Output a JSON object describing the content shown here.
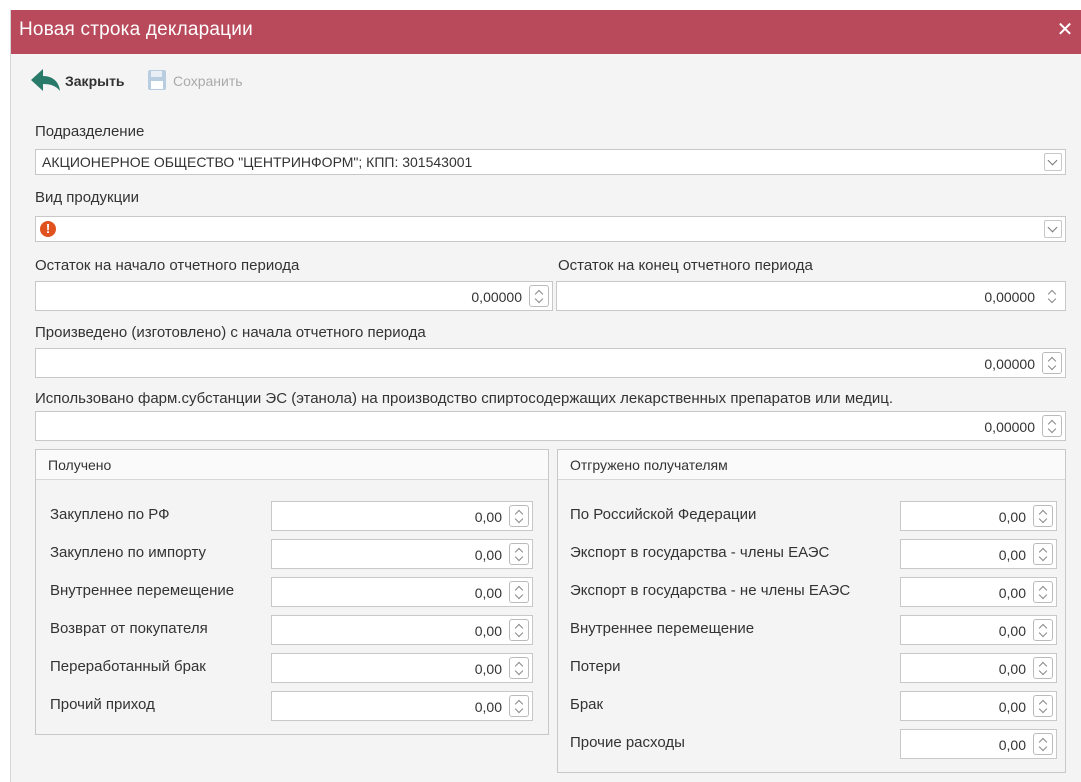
{
  "window": {
    "title": "Новая строка декларации",
    "close_glyph": "✕"
  },
  "toolbar": {
    "close_label": "Закрыть",
    "save_label": "Сохранить"
  },
  "fields": {
    "division_label": "Подразделение",
    "division_value": "АКЦИОНЕРНОЕ ОБЩЕСТВО \"ЦЕНТРИНФОРМ\"; КПП: 301543001",
    "product_type_label": "Вид продукции",
    "product_type_value": "",
    "opening_balance_label": "Остаток на начало отчетного периода",
    "opening_balance_value": "0,00000",
    "closing_balance_label": "Остаток на конец отчетного периода",
    "closing_balance_value": "0,00000",
    "produced_label": "Произведено (изготовлено) с начала отчетного периода",
    "produced_value": "0,00000",
    "used_label": "Использовано фарм.субстанции ЭС (этанола) на производство спиртосодержащих лекарственных препаратов или медиц.",
    "used_value": "0,00000"
  },
  "received": {
    "title": "Получено",
    "rows": [
      {
        "label": "Закуплено по РФ",
        "value": "0,00"
      },
      {
        "label": "Закуплено по импорту",
        "value": "0,00"
      },
      {
        "label": "Внутреннее перемещение",
        "value": "0,00"
      },
      {
        "label": "Возврат от покупателя",
        "value": "0,00"
      },
      {
        "label": "Переработанный брак",
        "value": "0,00"
      },
      {
        "label": "Прочий приход",
        "value": "0,00"
      }
    ]
  },
  "shipped": {
    "title": "Отгружено получателям",
    "rows": [
      {
        "label": "По Российской Федерации",
        "value": "0,00"
      },
      {
        "label": "Экспорт в государства - члены ЕАЭС",
        "value": "0,00"
      },
      {
        "label": "Экспорт в государства - не члены ЕАЭС",
        "value": "0,00"
      },
      {
        "label": "Внутреннее перемещение",
        "value": "0,00"
      },
      {
        "label": "Потери",
        "value": "0,00"
      },
      {
        "label": "Брак",
        "value": "0,00"
      },
      {
        "label": "Прочие расходы",
        "value": "0,00"
      }
    ]
  },
  "icons": {
    "close": "back-arrow-icon",
    "save": "floppy-disk-icon",
    "warning": "warning-icon"
  },
  "colors": {
    "titlebar": "#b94a5c",
    "close_arrow": "#2a7a6a",
    "warning": "#e0531f"
  }
}
